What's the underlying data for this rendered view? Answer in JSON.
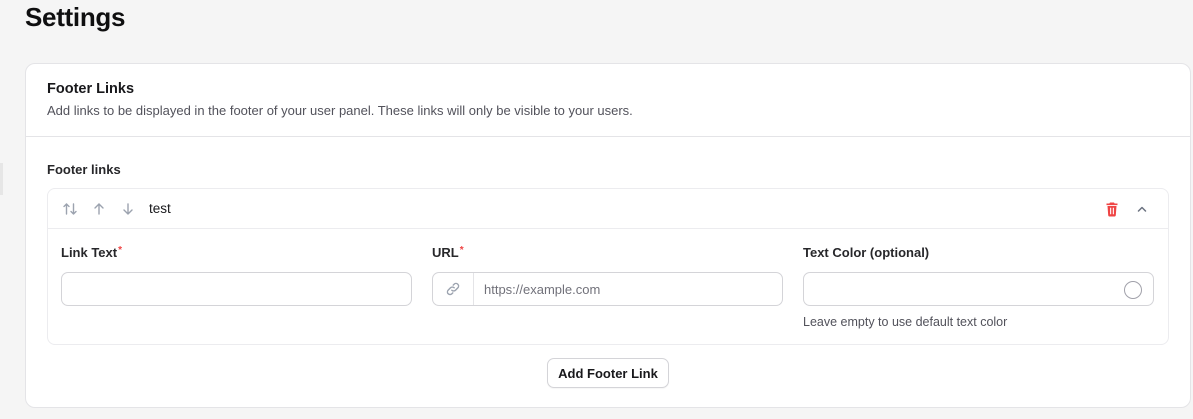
{
  "page": {
    "title": "Settings"
  },
  "section": {
    "title": "Footer Links",
    "description": "Add links to be displayed in the footer of your user panel. These links will only be visible to your users."
  },
  "repeater": {
    "label": "Footer links",
    "items": [
      {
        "label": "test",
        "icons": [
          "reorder-icon",
          "arrow-up-icon",
          "arrow-down-icon",
          "trash-icon",
          "chevron-up-icon"
        ],
        "fields": {
          "link_text": {
            "label": "Link Text",
            "required_mark": "*",
            "value": ""
          },
          "url": {
            "label": "URL",
            "required_mark": "*",
            "value": "",
            "placeholder": "https://example.com",
            "prefix_icon": "link-icon"
          },
          "text_color": {
            "label": "Text Color (optional)",
            "value": "",
            "hint": "Leave empty to use default text color"
          }
        }
      }
    ],
    "add_button_label": "Add Footer Link"
  },
  "colors": {
    "danger": "#ef4444",
    "border": "#e4e4e7",
    "background": "#f5f5f5"
  }
}
